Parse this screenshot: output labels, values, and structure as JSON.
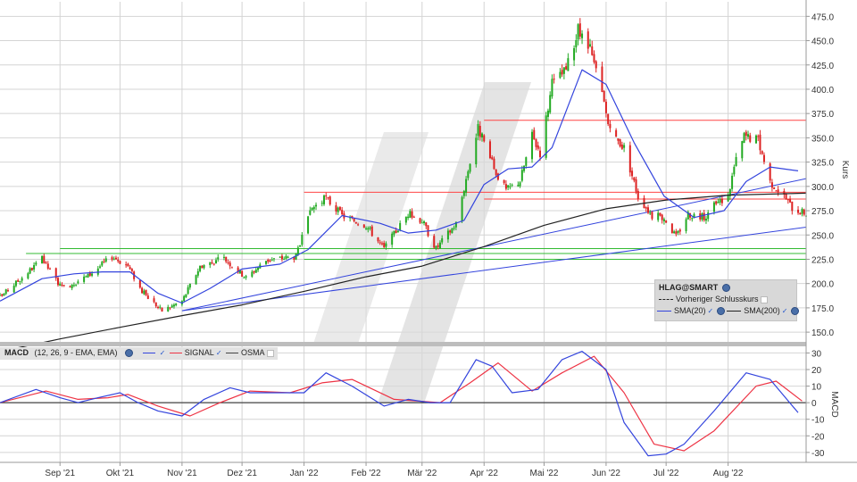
{
  "chart_data": [
    {
      "type": "candlestick",
      "symbol": "HLAG@SMART",
      "ylabel": "Kurs",
      "ylim": [
        140,
        490
      ],
      "yticks": [
        150,
        175,
        200,
        225,
        250,
        275,
        300,
        325,
        350,
        375,
        400,
        425,
        450,
        475
      ],
      "ytick_labels": [
        "150.0",
        "175.0",
        "200.0",
        "225.0",
        "250.0",
        "275.0",
        "300.0",
        "325.0",
        "350.0",
        "375.0",
        "400.0",
        "425.0",
        "450.0",
        "475.0"
      ],
      "x_axis": {
        "start": "2021-08-02",
        "end": "2022-09-09",
        "tick_dates": [
          "2021-09-01",
          "2021-10-01",
          "2021-11-01",
          "2021-12-01",
          "2022-01-01",
          "2022-02-01",
          "2022-03-01",
          "2022-04-01",
          "2022-05-01",
          "2022-06-01",
          "2022-07-01",
          "2022-08-01"
        ],
        "tick_labels": [
          "Sep '21",
          "Okt '21",
          "Nov '21",
          "Dez '21",
          "Jan '22",
          "Feb '22",
          "Mär '22",
          "Apr '22",
          "Mai '22",
          "Jun '22",
          "Jul '22",
          "Aug '22"
        ]
      },
      "price_path": [
        [
          "2021-08-02",
          186
        ],
        [
          "2021-08-16",
          212
        ],
        [
          "2021-08-23",
          225
        ],
        [
          "2021-09-02",
          195
        ],
        [
          "2021-09-15",
          208
        ],
        [
          "2021-09-27",
          228
        ],
        [
          "2021-10-05",
          218
        ],
        [
          "2021-10-12",
          192
        ],
        [
          "2021-10-22",
          172
        ],
        [
          "2021-11-01",
          182
        ],
        [
          "2021-11-10",
          218
        ],
        [
          "2021-11-22",
          226
        ],
        [
          "2021-12-03",
          206
        ],
        [
          "2021-12-13",
          224
        ],
        [
          "2021-12-28",
          228
        ],
        [
          "2022-01-05",
          278
        ],
        [
          "2022-01-12",
          288
        ],
        [
          "2022-01-20",
          270
        ],
        [
          "2022-02-01",
          260
        ],
        [
          "2022-02-10",
          236
        ],
        [
          "2022-02-22",
          272
        ],
        [
          "2022-03-01",
          265
        ],
        [
          "2022-03-08",
          236
        ],
        [
          "2022-03-18",
          262
        ],
        [
          "2022-03-25",
          326
        ],
        [
          "2022-03-29",
          360
        ],
        [
          "2022-04-06",
          318
        ],
        [
          "2022-04-12",
          296
        ],
        [
          "2022-04-19",
          306
        ],
        [
          "2022-04-25",
          352
        ],
        [
          "2022-04-29",
          335
        ],
        [
          "2022-05-05",
          405
        ],
        [
          "2022-05-12",
          420
        ],
        [
          "2022-05-18",
          460
        ],
        [
          "2022-05-24",
          440
        ],
        [
          "2022-05-30",
          395
        ],
        [
          "2022-06-03",
          355
        ],
        [
          "2022-06-10",
          340
        ],
        [
          "2022-06-17",
          290
        ],
        [
          "2022-06-24",
          270
        ],
        [
          "2022-06-30",
          268
        ],
        [
          "2022-07-06",
          248
        ],
        [
          "2022-07-12",
          272
        ],
        [
          "2022-07-20",
          268
        ],
        [
          "2022-07-26",
          282
        ],
        [
          "2022-08-01",
          290
        ],
        [
          "2022-08-04",
          320
        ],
        [
          "2022-08-09",
          352
        ],
        [
          "2022-08-16",
          348
        ],
        [
          "2022-08-22",
          305
        ],
        [
          "2022-08-29",
          290
        ],
        [
          "2022-09-02",
          278
        ],
        [
          "2022-09-09",
          272
        ]
      ],
      "sma20_path": [
        [
          "2021-08-02",
          182
        ],
        [
          "2021-08-23",
          205
        ],
        [
          "2021-09-08",
          210
        ],
        [
          "2021-09-22",
          212
        ],
        [
          "2021-10-06",
          212
        ],
        [
          "2021-10-20",
          190
        ],
        [
          "2021-11-01",
          180
        ],
        [
          "2021-11-15",
          195
        ],
        [
          "2021-12-01",
          215
        ],
        [
          "2021-12-20",
          220
        ],
        [
          "2022-01-03",
          235
        ],
        [
          "2022-01-20",
          270
        ],
        [
          "2022-02-08",
          262
        ],
        [
          "2022-02-22",
          252
        ],
        [
          "2022-03-08",
          255
        ],
        [
          "2022-03-22",
          265
        ],
        [
          "2022-04-01",
          302
        ],
        [
          "2022-04-13",
          318
        ],
        [
          "2022-04-25",
          320
        ],
        [
          "2022-05-05",
          340
        ],
        [
          "2022-05-20",
          420
        ],
        [
          "2022-06-01",
          405
        ],
        [
          "2022-06-15",
          345
        ],
        [
          "2022-06-30",
          290
        ],
        [
          "2022-07-15",
          268
        ],
        [
          "2022-07-30",
          275
        ],
        [
          "2022-08-10",
          305
        ],
        [
          "2022-08-22",
          320
        ],
        [
          "2022-09-05",
          316
        ]
      ],
      "sma200_path": [
        [
          "2021-08-02",
          130
        ],
        [
          "2021-09-01",
          143
        ],
        [
          "2021-10-01",
          155
        ],
        [
          "2021-11-01",
          167
        ],
        [
          "2021-12-01",
          178
        ],
        [
          "2022-01-01",
          192
        ],
        [
          "2022-02-01",
          207
        ],
        [
          "2022-03-01",
          218
        ],
        [
          "2022-04-01",
          238
        ],
        [
          "2022-05-01",
          260
        ],
        [
          "2022-06-01",
          277
        ],
        [
          "2022-07-01",
          286
        ],
        [
          "2022-08-01",
          291
        ],
        [
          "2022-09-09",
          293
        ]
      ],
      "horizontal_lines": [
        {
          "color": "#ff4444",
          "value": 368,
          "from": "2022-04-01",
          "to": "2022-09-09"
        },
        {
          "color": "#ff4444",
          "value": 294,
          "from": "2022-01-01",
          "to": "2022-09-09"
        },
        {
          "color": "#ff4444",
          "value": 287,
          "from": "2022-04-01",
          "to": "2022-09-09"
        },
        {
          "color": "#33bb33",
          "value": 236,
          "from": "2021-09-01",
          "to": "2022-09-09"
        },
        {
          "color": "#33bb33",
          "value": 231,
          "from": "2021-08-15",
          "to": "2022-09-09"
        },
        {
          "color": "#33bb33",
          "value": 225,
          "from": "2022-01-01",
          "to": "2022-09-09"
        }
      ],
      "trend_lines": [
        {
          "color": "#3344dd",
          "from": [
            "2021-11-01",
            172
          ],
          "to": [
            "2022-09-09",
            258
          ]
        },
        {
          "color": "#3344dd",
          "from": [
            "2021-11-01",
            172
          ],
          "to": [
            "2022-09-09",
            308
          ]
        }
      ],
      "legend": {
        "title": "HLAG@SMART",
        "prev_close": "Vorheriger Schlusskurs",
        "sma20": "SMA(20)",
        "sma200": "SMA(200)"
      },
      "colors": {
        "up": "#22aa22",
        "down": "#dd2222",
        "sma20": "#3344dd",
        "sma200": "#222222",
        "grid": "#d4d4d4"
      }
    },
    {
      "type": "line",
      "title": "MACD",
      "params": "(12, 26, 9 - EMA, EMA)",
      "ylabel": "MACD",
      "ylim": [
        -36,
        34
      ],
      "yticks": [
        -30,
        -20,
        -10,
        0,
        10,
        20,
        30
      ],
      "series": [
        {
          "name": "MACD",
          "color": "#3344dd",
          "path": [
            [
              "2021-08-02",
              0
            ],
            [
              "2021-08-20",
              8
            ],
            [
              "2021-09-01",
              3
            ],
            [
              "2021-09-10",
              0
            ],
            [
              "2021-09-20",
              3
            ],
            [
              "2021-10-01",
              6
            ],
            [
              "2021-10-10",
              0
            ],
            [
              "2021-10-20",
              -5
            ],
            [
              "2021-11-01",
              -8
            ],
            [
              "2021-11-12",
              2
            ],
            [
              "2021-11-25",
              9
            ],
            [
              "2021-12-05",
              6
            ],
            [
              "2021-12-20",
              6
            ],
            [
              "2022-01-01",
              6
            ],
            [
              "2022-01-12",
              18
            ],
            [
              "2022-01-25",
              10
            ],
            [
              "2022-02-10",
              -2
            ],
            [
              "2022-02-22",
              2
            ],
            [
              "2022-03-05",
              0
            ],
            [
              "2022-03-15",
              0
            ],
            [
              "2022-03-28",
              26
            ],
            [
              "2022-04-05",
              22
            ],
            [
              "2022-04-15",
              6
            ],
            [
              "2022-04-28",
              8
            ],
            [
              "2022-05-10",
              26
            ],
            [
              "2022-05-20",
              31
            ],
            [
              "2022-06-01",
              20
            ],
            [
              "2022-06-10",
              -12
            ],
            [
              "2022-06-22",
              -32
            ],
            [
              "2022-07-01",
              -31
            ],
            [
              "2022-07-10",
              -25
            ],
            [
              "2022-07-25",
              -5
            ],
            [
              "2022-08-10",
              18
            ],
            [
              "2022-08-22",
              14
            ],
            [
              "2022-09-05",
              -6
            ]
          ]
        },
        {
          "name": "SIGNAL",
          "color": "#ee3344",
          "path": [
            [
              "2021-08-02",
              0
            ],
            [
              "2021-08-25",
              7
            ],
            [
              "2021-09-10",
              2
            ],
            [
              "2021-09-25",
              3
            ],
            [
              "2021-10-05",
              5
            ],
            [
              "2021-10-20",
              -2
            ],
            [
              "2021-11-05",
              -8
            ],
            [
              "2021-11-20",
              0
            ],
            [
              "2021-12-05",
              7
            ],
            [
              "2021-12-25",
              6
            ],
            [
              "2022-01-10",
              12
            ],
            [
              "2022-01-25",
              14
            ],
            [
              "2022-02-15",
              2
            ],
            [
              "2022-03-10",
              0
            ],
            [
              "2022-03-25",
              12
            ],
            [
              "2022-04-08",
              24
            ],
            [
              "2022-04-25",
              7
            ],
            [
              "2022-05-10",
              18
            ],
            [
              "2022-05-26",
              28
            ],
            [
              "2022-06-10",
              6
            ],
            [
              "2022-06-25",
              -25
            ],
            [
              "2022-07-10",
              -29
            ],
            [
              "2022-07-25",
              -17
            ],
            [
              "2022-08-15",
              10
            ],
            [
              "2022-08-25",
              13
            ],
            [
              "2022-09-07",
              1
            ]
          ]
        },
        {
          "name": "OSMA",
          "color": "#444444",
          "path": [
            [
              "2021-08-02",
              0
            ],
            [
              "2022-09-09",
              0
            ]
          ]
        }
      ]
    }
  ]
}
